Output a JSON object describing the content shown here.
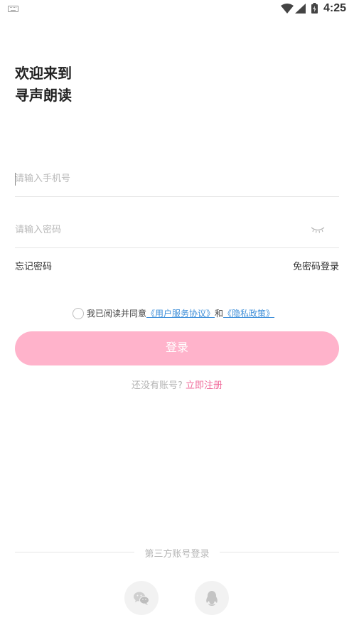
{
  "status_bar": {
    "time": "4:25",
    "icons": [
      "keyboard-icon",
      "wifi-icon",
      "signal-icon",
      "battery-icon"
    ]
  },
  "welcome": {
    "line1": "欢迎来到",
    "line2": "寻声朗读"
  },
  "phone_input": {
    "placeholder": "请输入手机号",
    "value": ""
  },
  "password_input": {
    "placeholder": "请输入密码",
    "value": "",
    "toggle_icon": "eye-closed-icon"
  },
  "forgot_password": "忘记密码",
  "code_login": "免密码登录",
  "agreement": {
    "checked": false,
    "prefix": "我已阅读并同意",
    "user_agreement": "《用户服务协议》",
    "and": "和",
    "privacy_policy": "《隐私政策》"
  },
  "login_button": "登录",
  "register": {
    "question": "还没有账号?",
    "link": "立即注册"
  },
  "third_party": {
    "title": "第三方账号登录",
    "options": [
      "wechat-icon",
      "qq-icon"
    ]
  },
  "colors": {
    "primary_pink": "#ffb3cb",
    "link_pink": "#f06c9b",
    "link_blue": "#3f8fd9"
  }
}
